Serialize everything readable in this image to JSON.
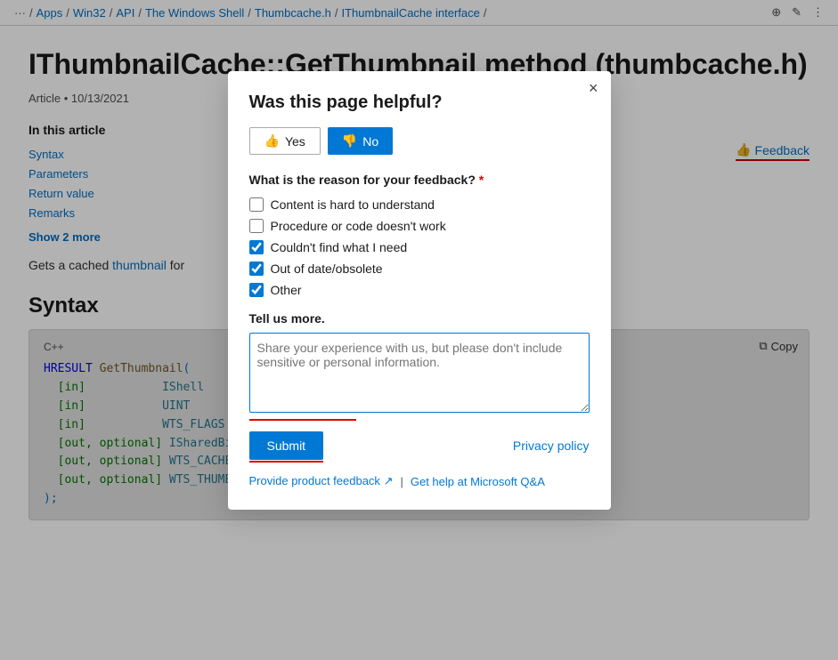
{
  "breadcrumb": {
    "items": [
      "...",
      "Apps",
      "Win32",
      "API",
      "The Windows Shell",
      "Thumbcache.h",
      "IThumbnailCache interface"
    ],
    "separators": [
      "/",
      "/",
      "/",
      "/",
      "/",
      "/"
    ]
  },
  "page": {
    "title": "IThumbnailCache::GetThumbnail method (thumbcache.h)",
    "article_meta": "Article • 10/13/2021",
    "toc_heading": "In this article",
    "toc_items": [
      "Syntax",
      "Parameters",
      "Return value",
      "Remarks"
    ],
    "show_more": "Show 2 more",
    "intro_text": "Gets a cached thumbnail for",
    "intro_highlight": "thumbnail",
    "syntax_heading": "Syntax",
    "code_lang": "C++",
    "code_copy": "Copy",
    "code_lines": [
      "HRESULT GetThumbnail(",
      "  [in]           IShell",
      "  [in]           UINT",
      "  [in]           WTS_FLAGS        flags,",
      "  [out, optional] ISharedBitmap   **ppvThumb,",
      "  [out, optional] WTS_CACHEFLAGS  *pOutFlags,",
      "  [out, optional] WTS_THUMBNAILID *pThumbnailID",
      ");"
    ]
  },
  "feedback_btn": {
    "label": "Feedback"
  },
  "modal": {
    "title": "Was this page helpful?",
    "close_label": "×",
    "yes_label": "Yes",
    "no_label": "No",
    "question_label": "What is the reason for your feedback?",
    "required_marker": "*",
    "checkboxes": [
      {
        "label": "Content is hard to understand",
        "checked": false
      },
      {
        "label": "Procedure or code doesn't work",
        "checked": false
      },
      {
        "label": "Couldn't find what I need",
        "checked": true
      },
      {
        "label": "Out of date/obsolete",
        "checked": true
      },
      {
        "label": "Other",
        "checked": true
      }
    ],
    "tell_more_label": "Tell us more.",
    "textarea_placeholder": "Share your experience with us, but please don't include sensitive or personal information.",
    "submit_label": "Submit",
    "privacy_label": "Privacy policy",
    "provide_feedback_label": "Provide product feedback",
    "get_help_label": "Get help at Microsoft Q&A",
    "separator": "|"
  },
  "icons": {
    "globe": "⊕",
    "pencil": "✎",
    "dots": "⋮",
    "copy": "⧉",
    "thumb_up": "👍",
    "thumb_down": "👎",
    "external": "↗"
  }
}
